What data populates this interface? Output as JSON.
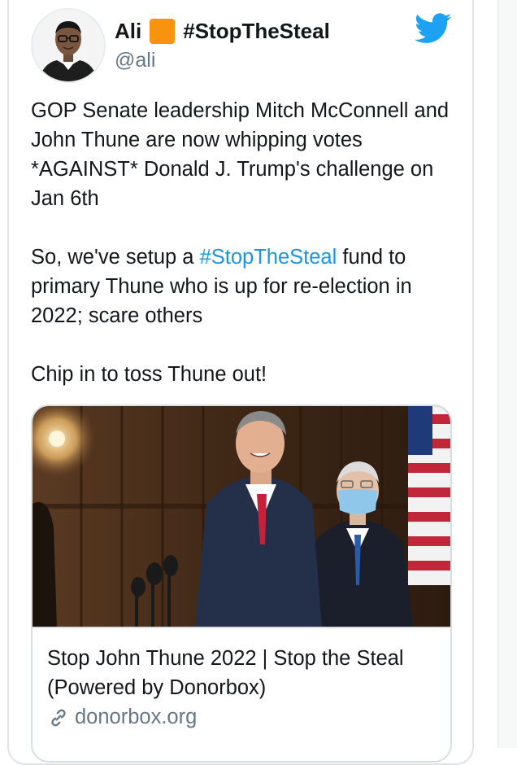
{
  "tweet": {
    "author_name": "Ali",
    "author_emoji": "orange-square",
    "author_hashtag": "#StopTheSteal",
    "handle": "@ali",
    "paragraph1": "GOP Senate leadership Mitch McConnell and John Thune are now whipping votes *AGAINST* Donald J. Trump's challenge on Jan 6th",
    "paragraph2_pre": "So, we've setup a ",
    "paragraph2_hashtag": "#StopTheSteal",
    "paragraph2_post": " fund to primary Thune who is up for re-election in 2022; scare others",
    "paragraph3": "Chip in to toss Thune out!"
  },
  "link_card": {
    "title": "Stop John Thune 2022 | Stop the Steal (Powered by Donorbox)",
    "domain": "donorbox.org",
    "icon": "link-icon"
  },
  "colors": {
    "text": "#14171a",
    "secondary": "#657786",
    "hashtag": "#1b95e0",
    "twitter_blue": "#1da1f2",
    "emoji_orange": "#f7930e"
  }
}
